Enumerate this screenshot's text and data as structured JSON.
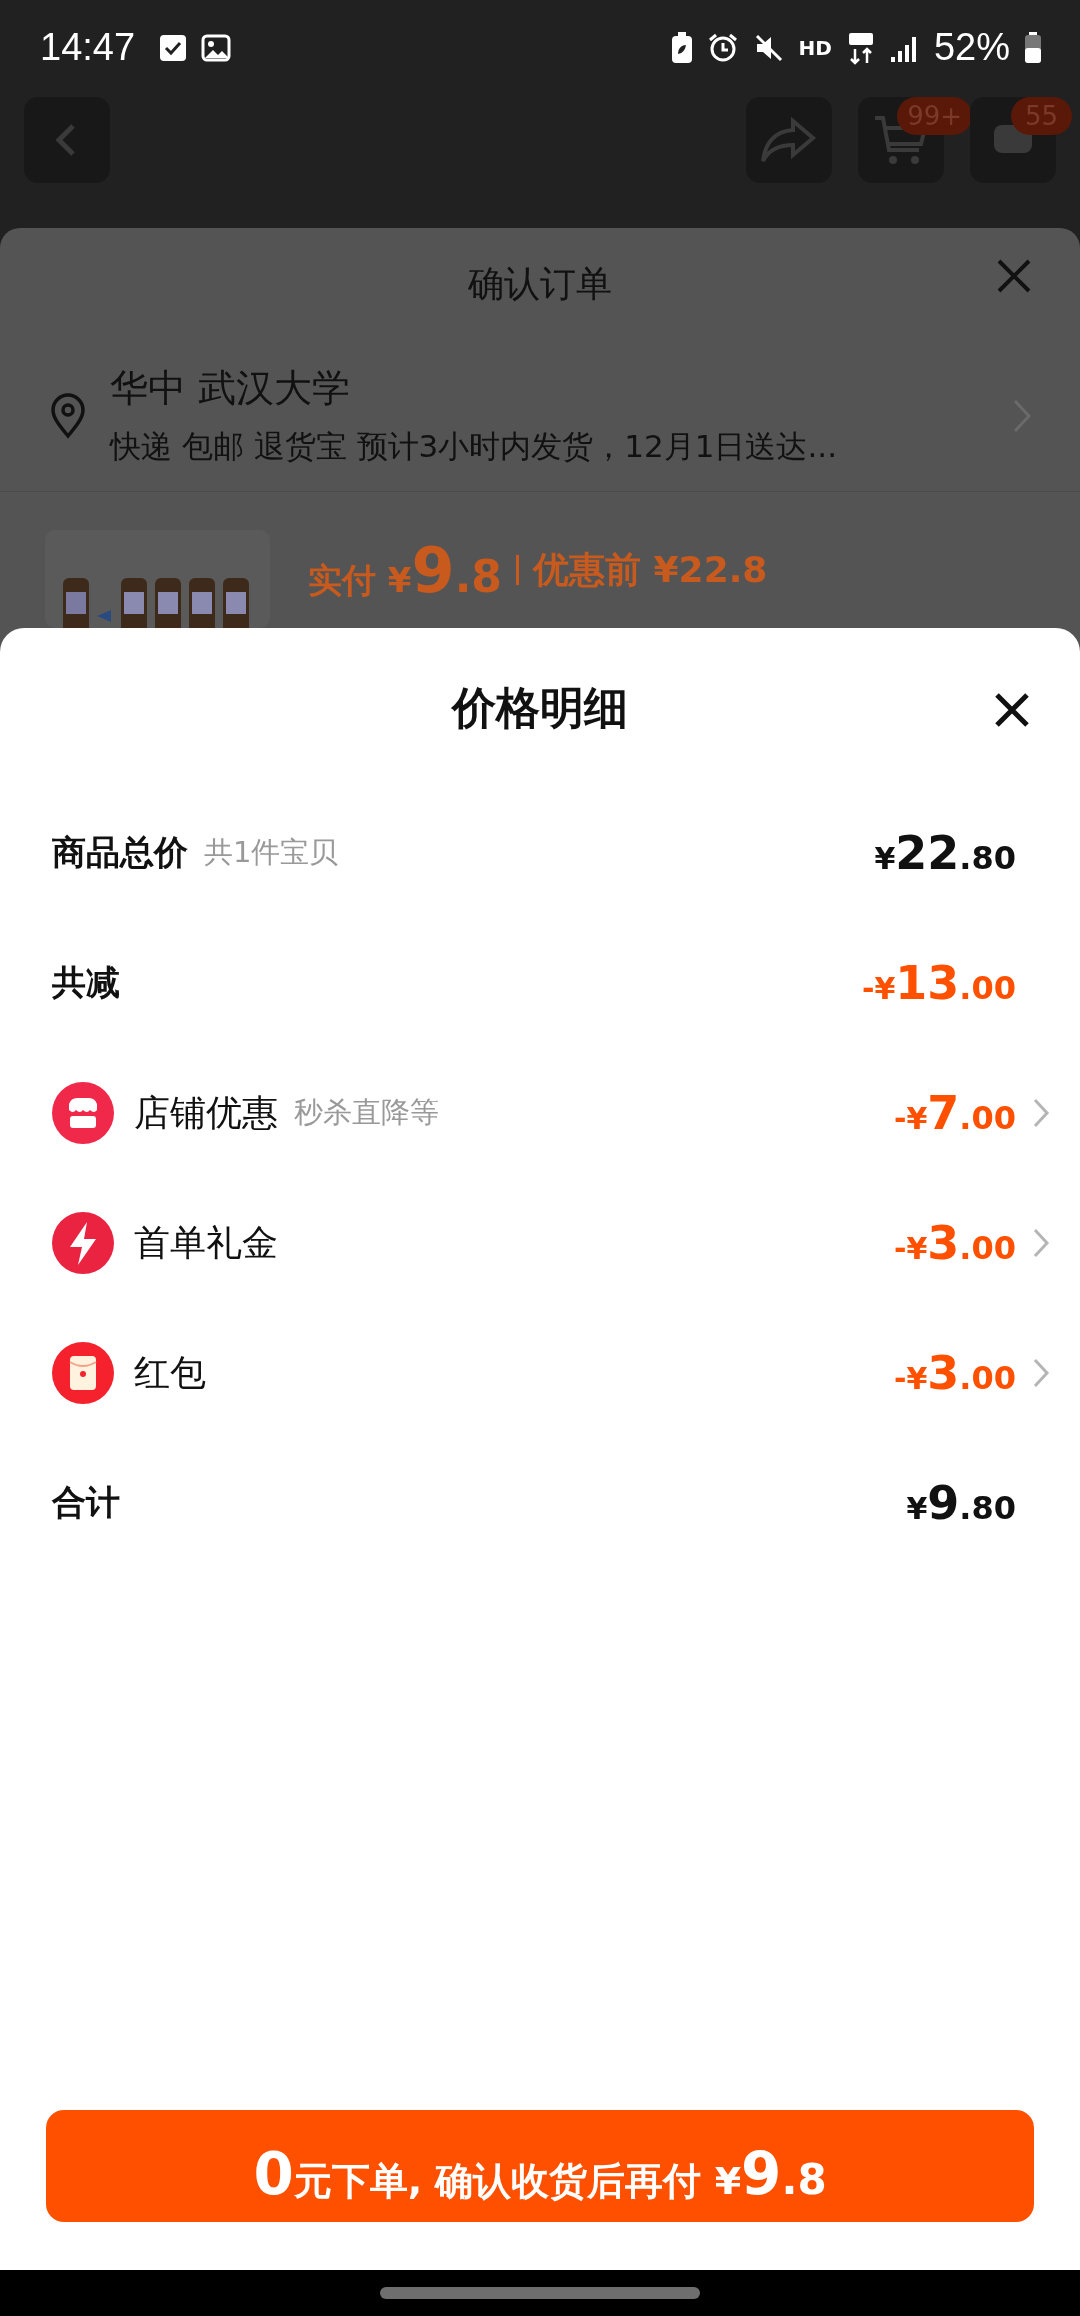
{
  "status_bar": {
    "time": "14:47",
    "network_label": "HD",
    "battery": "52%"
  },
  "header": {
    "cart_badge": "99+",
    "message_badge": "55"
  },
  "confirm_order": {
    "title": "确认订单",
    "address": {
      "name": "华中 武汉大学",
      "delivery": "快递 包邮 退货宝 预计3小时内发货，12月1日送达..."
    },
    "product": {
      "paid_label": "实付",
      "paid": "¥9.8",
      "original_label": "优惠前",
      "original": "¥22.8"
    }
  },
  "price_detail": {
    "title": "价格明细",
    "rows": [
      {
        "kind": "plain",
        "label": "商品总价",
        "hint": "共1件宝贝",
        "amount": "¥22.80",
        "discount": false
      },
      {
        "kind": "plain",
        "label": "共减",
        "amount": "-¥13.00",
        "discount": true
      },
      {
        "kind": "store",
        "label": "店铺优惠",
        "hint": "秒杀直降等",
        "amount": "-¥7.00",
        "discount": true
      },
      {
        "kind": "lightning",
        "label": "首单礼金",
        "amount": "-¥3.00",
        "discount": true
      },
      {
        "kind": "envelope",
        "label": "红包",
        "amount": "-¥3.00",
        "discount": true
      },
      {
        "kind": "plain",
        "label": "合计",
        "amount": "¥9.80",
        "discount": false
      }
    ]
  },
  "submit_button": {
    "label": "0元下单, 确认收货后再付 ¥9.8"
  }
}
